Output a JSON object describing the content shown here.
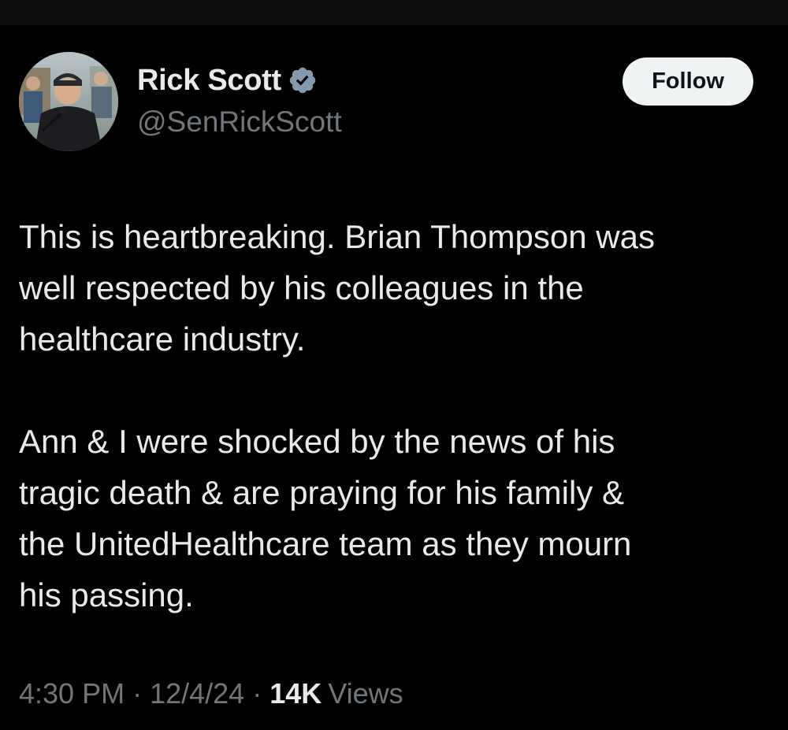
{
  "author": {
    "display_name": "Rick Scott",
    "handle": "@SenRickScott",
    "verified_badge": "verified-badge-icon",
    "verified_color": "#829aab"
  },
  "follow_button": {
    "label": "Follow"
  },
  "tweet": {
    "paragraph_1": [
      "This is heartbreaking. Brian Thompson was",
      "well respected by his colleagues in the",
      "healthcare industry."
    ],
    "paragraph_2": [
      "Ann & I were shocked by the news of his",
      "tragic death & are praying for his family &",
      "the UnitedHealthcare team as they mourn",
      "his passing."
    ]
  },
  "meta": {
    "time": "4:30 PM",
    "separator": "·",
    "date": "12/4/24",
    "views_count": "14K",
    "views_label": "Views"
  },
  "colors": {
    "background": "#000000",
    "primary_text": "#e7e9ea",
    "secondary_text": "#71767b",
    "button_background": "#eff3f4"
  }
}
